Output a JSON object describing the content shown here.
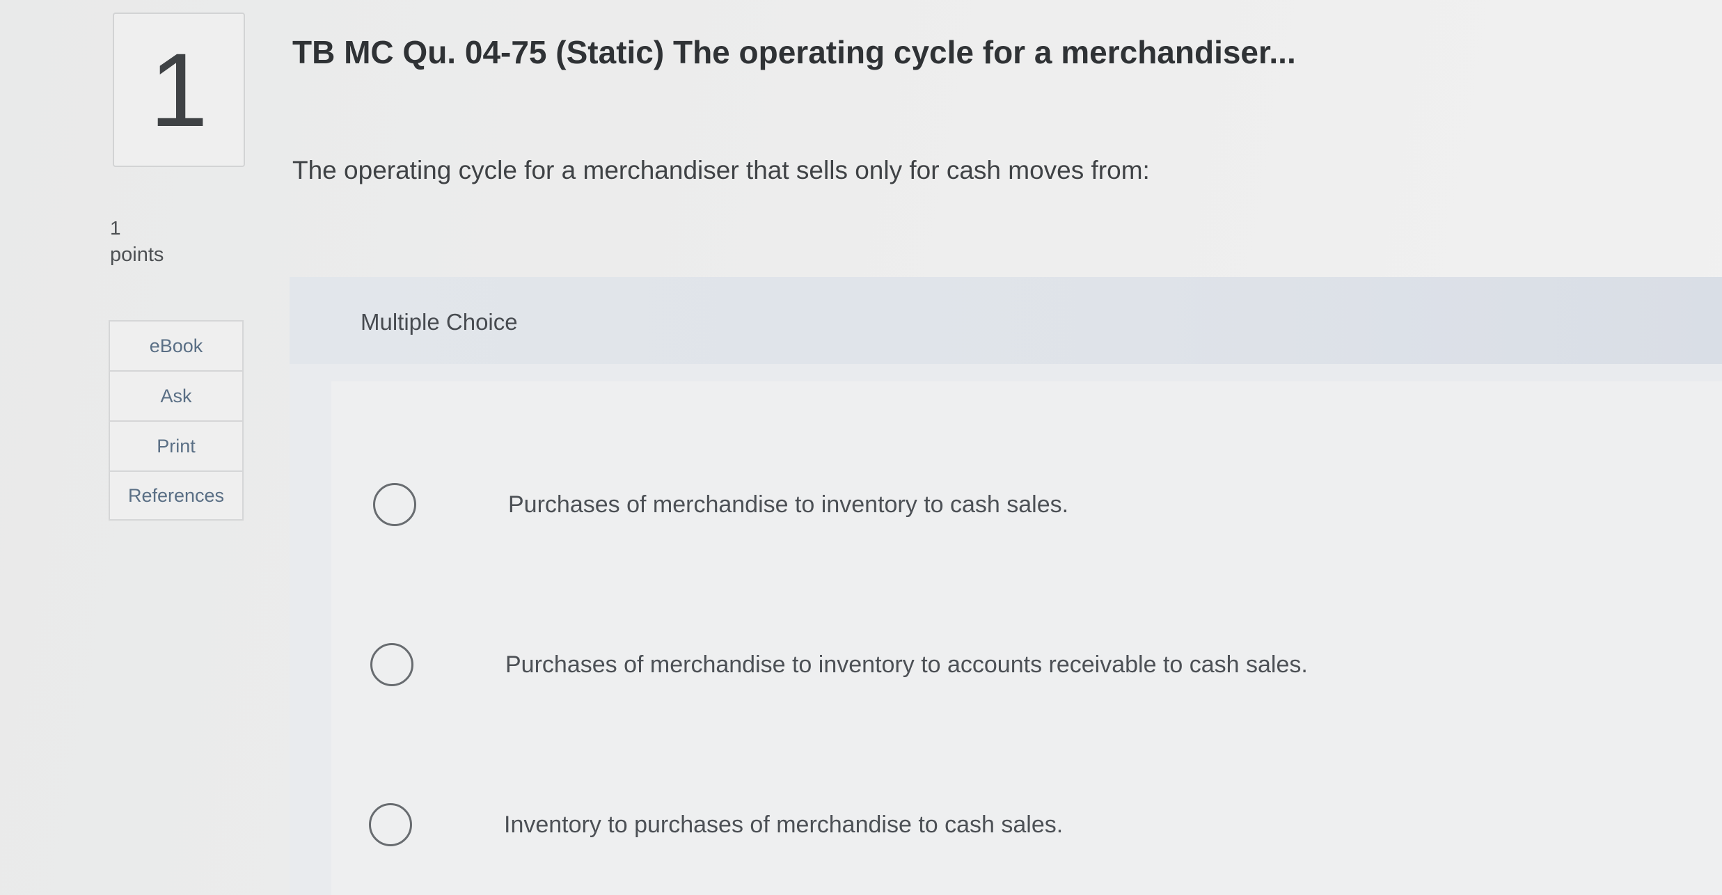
{
  "question": {
    "number": "1",
    "points_value": "1",
    "points_label": "points",
    "title": "TB MC Qu. 04-75 (Static) The operating cycle for a merchandiser...",
    "prompt": "The operating cycle for a merchandiser that sells only for cash moves from:"
  },
  "tools": {
    "items": [
      {
        "label": "eBook"
      },
      {
        "label": "Ask"
      },
      {
        "label": "Print"
      },
      {
        "label": "References"
      }
    ]
  },
  "answer": {
    "type_label": "Multiple Choice",
    "choices": [
      {
        "text": "Purchases of merchandise to inventory to cash sales.",
        "selected": false
      },
      {
        "text": "Purchases of merchandise to inventory to accounts receivable to cash sales.",
        "selected": false
      },
      {
        "text": "Inventory to purchases of merchandise to cash sales.",
        "selected": false
      }
    ]
  },
  "colors": {
    "page_background": "#ededed",
    "panel_background": "#e9ebee",
    "tool_text": "#5a6f85",
    "radio_border": "#686c70"
  }
}
